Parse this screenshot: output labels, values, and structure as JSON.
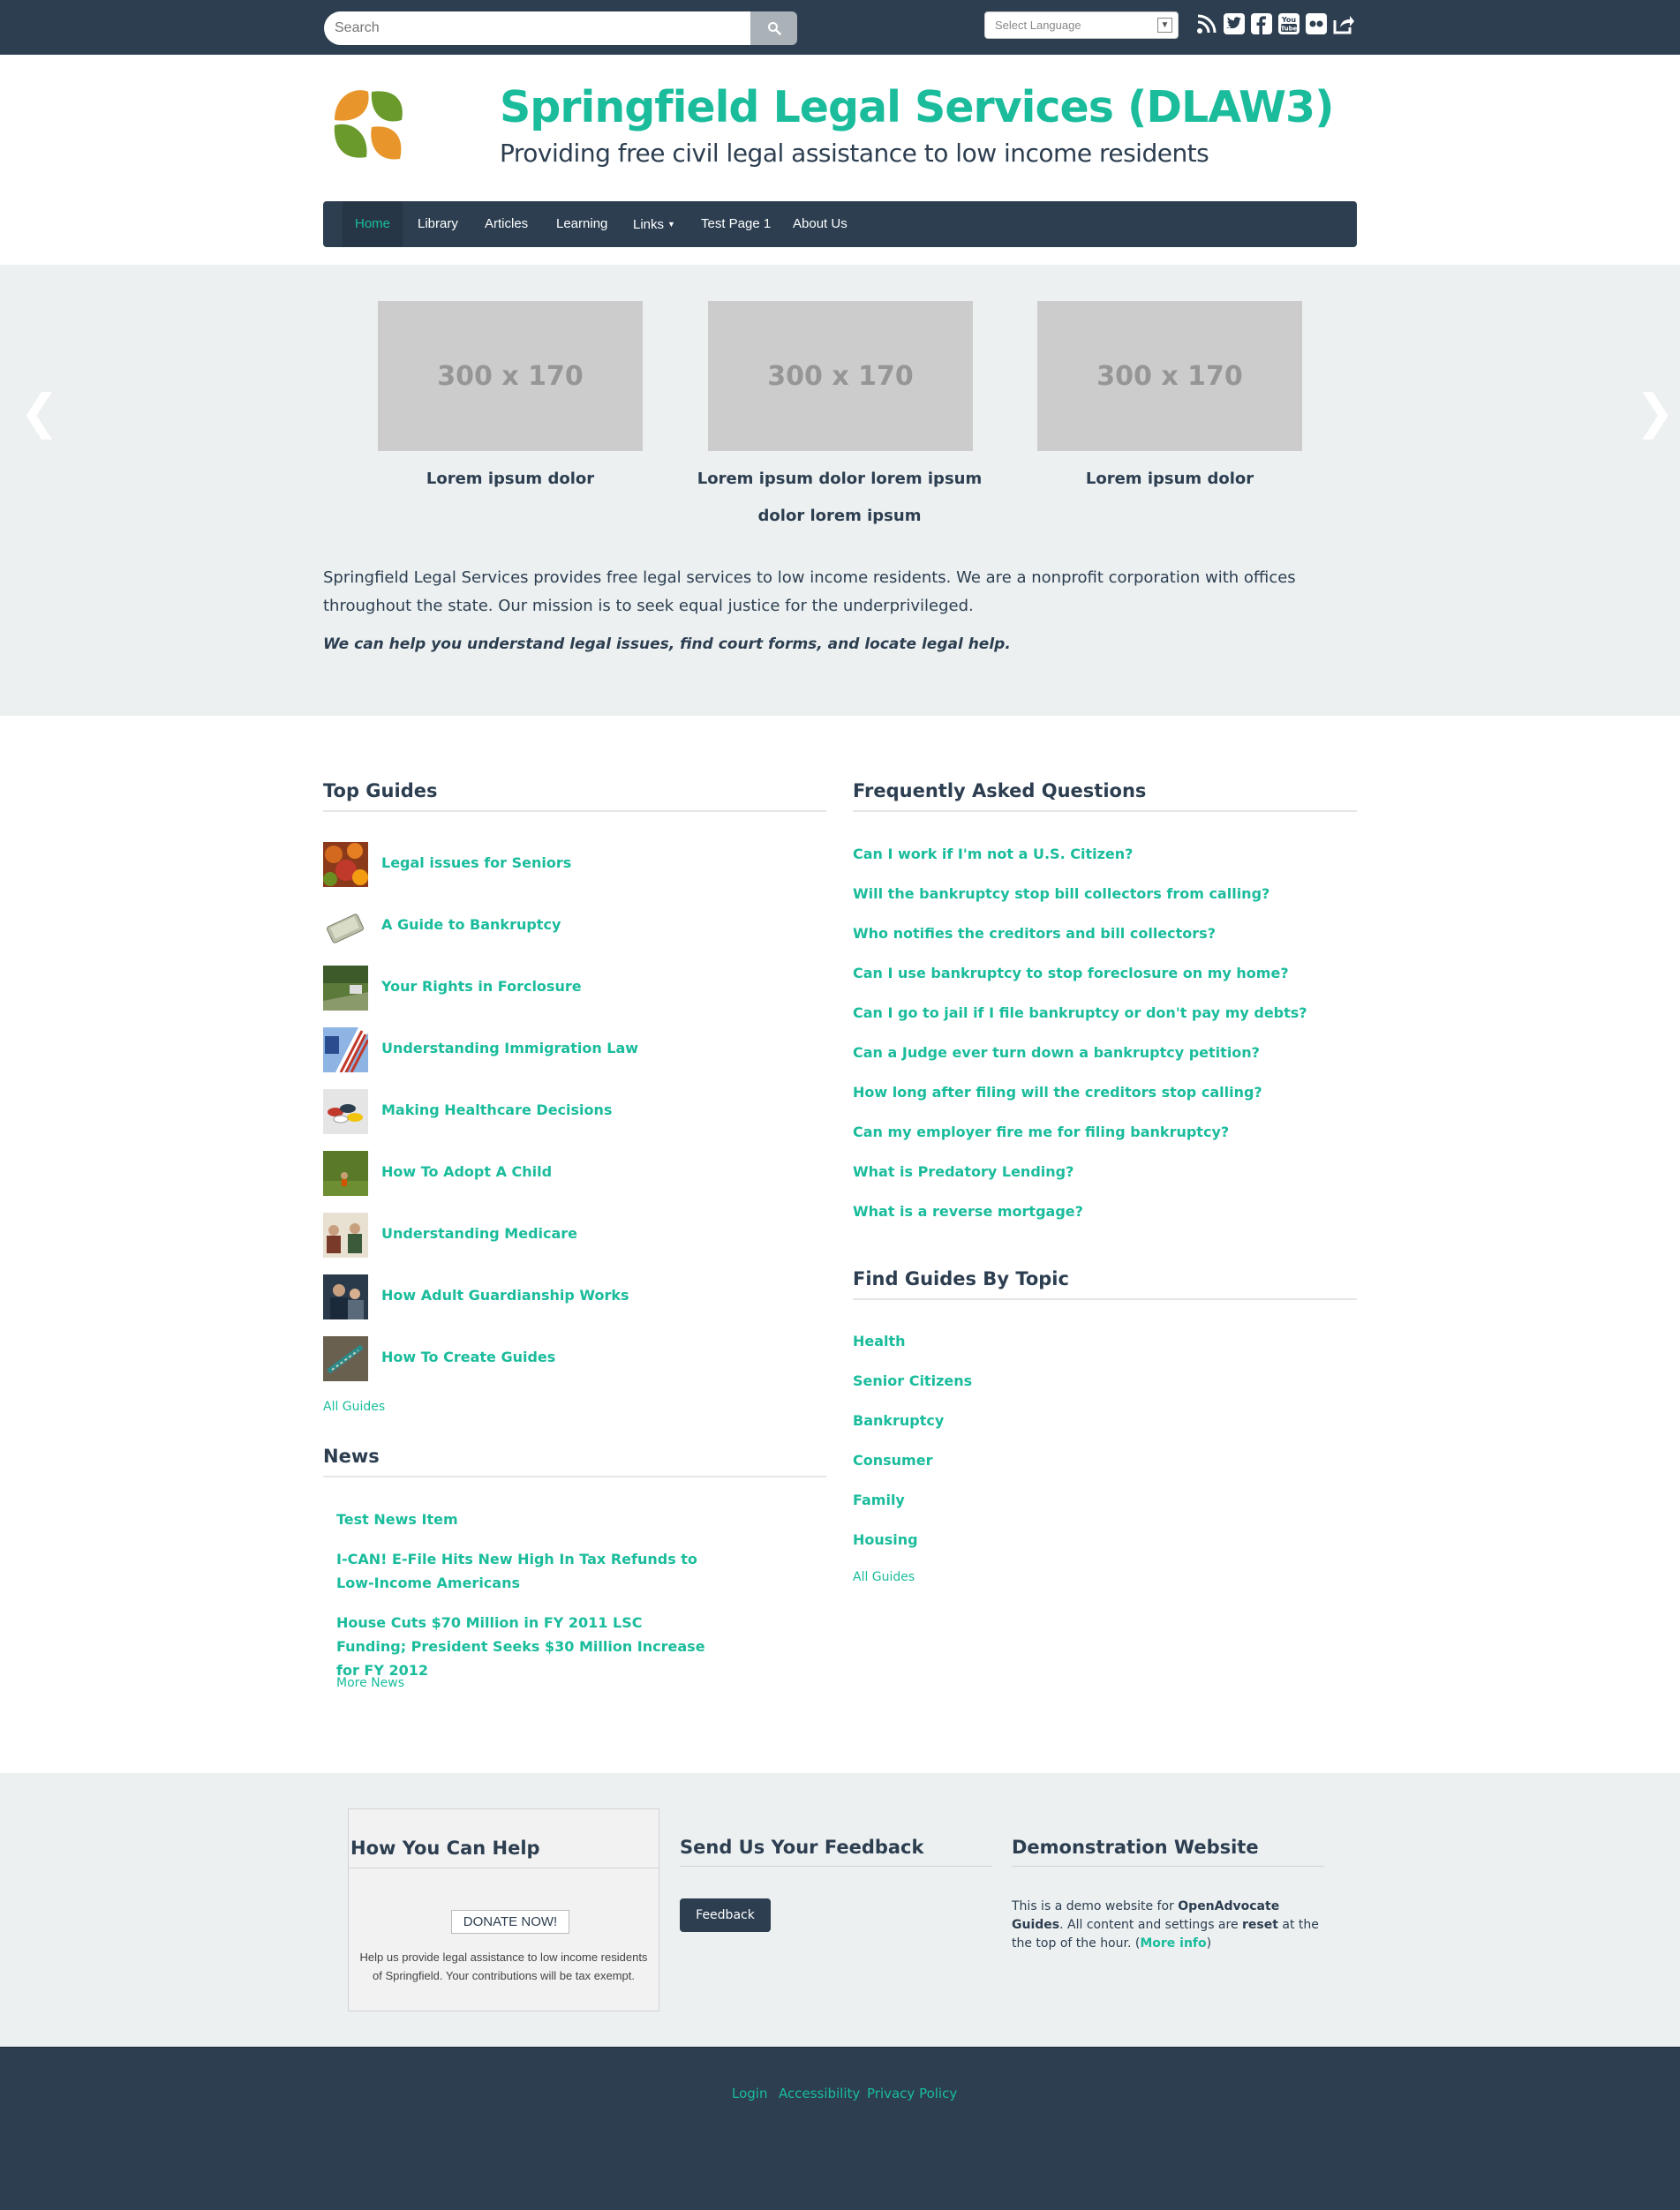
{
  "topbar": {
    "search_placeholder": "Search",
    "language_select": "Select Language",
    "social_icons": [
      "rss-icon",
      "twitter-icon",
      "facebook-icon",
      "youtube-icon",
      "flickr-icon",
      "share-icon"
    ]
  },
  "header": {
    "title": "Springfield Legal Services (DLAW3)",
    "subtitle": "Providing free civil legal assistance to low income residents"
  },
  "nav": {
    "items": [
      "Home",
      "Library",
      "Articles",
      "Learning",
      "Links",
      "Test Page 1",
      "About Us"
    ],
    "active": "Home"
  },
  "carousel": {
    "slides": [
      {
        "image_label": "300 x 170",
        "caption": "Lorem ipsum dolor"
      },
      {
        "image_label": "300 x 170",
        "caption": "Lorem ipsum dolor lorem ipsum dolor lorem ipsum"
      },
      {
        "image_label": "300 x 170",
        "caption": "Lorem ipsum dolor"
      }
    ],
    "prev_glyph": "❮",
    "next_glyph": "❯"
  },
  "intro": {
    "text": "Springfield Legal Services provides free legal services to low income residents. We are a nonprofit corporation with offices throughout the state. Our mission is to seek equal justice for the underprivileged.",
    "tagline": "We can help you understand legal issues, find court forms,  and locate legal help."
  },
  "top_guides": {
    "title": "Top Guides",
    "items": [
      "Legal issues for Seniors",
      "A Guide to Bankruptcy",
      "Your Rights in Forclosure",
      "Understanding Immigration Law",
      "Making Healthcare Decisions",
      "How To Adopt A Child",
      "Understanding Medicare",
      "How Adult Guardianship Works",
      "How To Create Guides"
    ],
    "all_link": "All Guides"
  },
  "faq": {
    "title": "Frequently Asked Questions",
    "items": [
      "Can I work if I'm not a U.S. Citizen?",
      "Will the bankruptcy stop bill collectors from calling?",
      "Who notifies the creditors and bill collectors?",
      "Can I use bankruptcy to stop foreclosure on my home?",
      "Can I go to jail if I file bankruptcy or don't pay my debts?",
      "Can a Judge ever turn down a bankruptcy petition?",
      "How long after filing will the creditors stop calling?",
      "Can my employer fire me for filing bankruptcy?",
      "What is Predatory Lending?",
      "What is a reverse mortgage?"
    ]
  },
  "topics": {
    "title": "Find Guides By Topic",
    "items": [
      "Health",
      "Senior Citizens",
      "Bankruptcy",
      "Consumer",
      "Family",
      "Housing"
    ],
    "all_link": "All Guides"
  },
  "news": {
    "title": "News",
    "items": [
      "Test News Item",
      "I-CAN! E-File Hits New High In Tax Refunds to Low-Income Americans",
      "House Cuts $70 Million in FY 2011 LSC Funding; President Seeks $30 Million Increase for FY 2012"
    ],
    "more_link": "More News"
  },
  "help": {
    "title": "How You Can Help",
    "donate_label": "DONATE NOW!",
    "text": "Help us provide legal assistance to low income residents of Springfield. Your contributions will be tax exempt."
  },
  "feedback": {
    "title": "Send Us Your Feedback",
    "button": "Feedback"
  },
  "demo": {
    "title": "Demonstration Website",
    "text_1": "This is  a demo website for ",
    "brand": "OpenAdvocate Guides",
    "text_2": ".  All content and settings are  ",
    "reset": "reset",
    "text_3": " at the the top of the hour.  (",
    "more_info": "More info",
    "text_4": ")"
  },
  "footer": {
    "links": [
      "Login",
      "Accessibility",
      "Privacy Policy"
    ]
  },
  "colors": {
    "brand_dark": "#2c3e50",
    "accent": "#1abc9c",
    "band": "#ecf0f1"
  }
}
